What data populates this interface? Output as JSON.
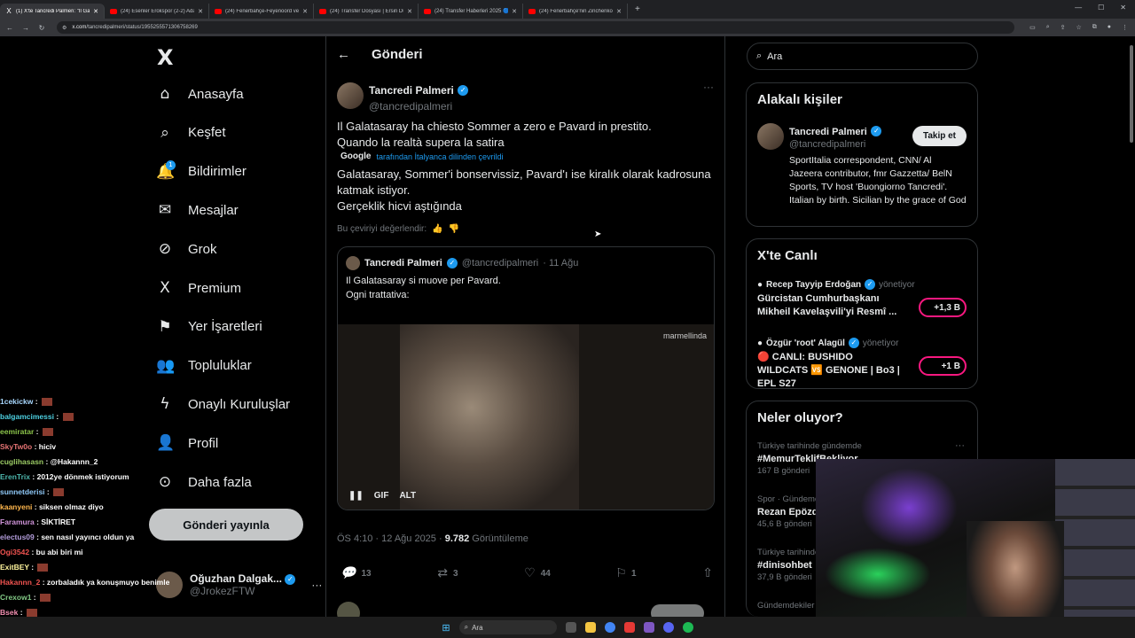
{
  "tabs": [
    {
      "label": "(1) X'te Tancredi Palmeri: \"Il Ga",
      "type": "x",
      "active": true
    },
    {
      "label": "(24) Esenler Erokspor (2-2) Ada",
      "type": "yt"
    },
    {
      "label": "(24) Fenerbahçe-Feyenoord ve",
      "type": "yt"
    },
    {
      "label": "(24) Transfer Dosyası | Ersin Dü",
      "type": "yt"
    },
    {
      "label": "(24) Transfer Haberleri 2025 🔵",
      "type": "yt"
    },
    {
      "label": "(24) Fenerbahçe'nin Zinchenko",
      "type": "yt"
    }
  ],
  "address": {
    "domain": "x.com",
    "path": "/tancredipalmeri/status/1955255571306758269"
  },
  "nav": {
    "logo": "X",
    "items": [
      {
        "label": "Anasayfa",
        "icon": "⌂",
        "name": "home"
      },
      {
        "label": "Keşfet",
        "icon": "⌕",
        "name": "explore"
      },
      {
        "label": "Bildirimler",
        "icon": "🔔",
        "name": "notifications",
        "badge": "1"
      },
      {
        "label": "Mesajlar",
        "icon": "✉",
        "name": "messages"
      },
      {
        "label": "Grok",
        "icon": "⊘",
        "name": "grok"
      },
      {
        "label": "Premium",
        "icon": "X",
        "name": "premium"
      },
      {
        "label": "Yer İşaretleri",
        "icon": "⚑",
        "name": "bookmarks"
      },
      {
        "label": "Topluluklar",
        "icon": "👥",
        "name": "communities"
      },
      {
        "label": "Onaylı Kuruluşlar",
        "icon": "ϟ",
        "name": "verified-orgs"
      },
      {
        "label": "Profil",
        "icon": "👤",
        "name": "profile"
      },
      {
        "label": "Daha fazla",
        "icon": "⊙",
        "name": "more"
      }
    ],
    "post_button": "Gönderi yayınla",
    "account_name": "Oğuzhan Dalgak...",
    "account_handle": "@JrokezFTW"
  },
  "main": {
    "header": "Gönderi",
    "author_name": "Tancredi Palmeri",
    "author_handle": "@tancredipalmeri",
    "text_line1": "Il Galatasaray ha chiesto Sommer a zero e Pavard in prestito.",
    "text_line2": "Quando la realtà supera la satira",
    "translate_brand": "Google",
    "translate_note": "tarafından İtalyanca dilinden çevrildi",
    "translated1": "Galatasaray, Sommer'i bonservissiz, Pavard'ı ise kiralık olarak kadrosuna katmak istiyor.",
    "translated2": "Gerçeklik hicvi aştığında",
    "rate": "Bu çeviriyi değerlendir:",
    "quote": {
      "name": "Tancredi Palmeri",
      "handle": "@tancredipalmeri",
      "date": "· 11 Ağu",
      "line1": "Il Galatasaray si muove per Pavard.",
      "line2": "Ogni trattativa:",
      "watermark": "marmellinda",
      "gif": "GIF",
      "alt": "ALT"
    },
    "time": "ÖS 4:10 · 12 Ağu 2025 ·",
    "views": "9.782",
    "views_label": "Görüntüleme",
    "actions": {
      "replies": "13",
      "reposts": "3",
      "likes": "44",
      "bookmarks": "1"
    }
  },
  "right": {
    "search_placeholder": "Ara",
    "relevant_title": "Alakalı kişiler",
    "rel_name": "Tancredi Palmeri",
    "rel_handle": "@tancredipalmeri",
    "follow": "Takip et",
    "bio": "SportItalia correspondent, CNN/ Al Jazeera contributor, fmr Gazzetta/ BelN Sports, TV host 'Buongiorno Tancredi'. Italian by birth. Sicilian by the grace of God",
    "live_title": "X'te Canlı",
    "live": [
      {
        "host": "Recep Tayyip Erdoğan",
        "role": "yönetiyor",
        "title": "Gürcistan Cumhurbaşkanı Mikheil Kavelaşvili'yi Resmî ...",
        "count": "+1,3 B"
      },
      {
        "host": "Özgür 'root' Alagül",
        "role": "yönetiyor",
        "title": "🔴 CANLI: BUSHIDO WILDCATS 🆚 GENONE | Bo3 | EPL S27",
        "count": "+1 B"
      }
    ],
    "trends_title": "Neler oluyor?",
    "trends": [
      {
        "context": "Türkiye tarihinde gündemde",
        "name": "#MemurTeklifBekliyor",
        "count": "167 B gönderi"
      },
      {
        "context": "Spor · Gündemde",
        "name": "Rezan Epözdemir",
        "count": "45,6 B gönderi"
      },
      {
        "context": "Türkiye tarihinde gündemde",
        "name": "#dinisohbet",
        "count": "37,9 B gönderi"
      },
      {
        "context": "Gündemdekiler",
        "name": "",
        "count": ""
      }
    ]
  },
  "chat": [
    {
      "user": "1cekickw",
      "msg": "",
      "color": "#a8d8ff"
    },
    {
      "user": "balgamcimessi",
      "msg": "",
      "color": "#4dd0e1"
    },
    {
      "user": "eemiratar",
      "msg": "",
      "color": "#8bc34a"
    },
    {
      "user": "SkyTw0o",
      "msg": "hiciv",
      "color": "#e57373"
    },
    {
      "user": "cuglihasasn",
      "msg": "@Hakannn_2",
      "color": "#9ccc65"
    },
    {
      "user": "ErenTrix",
      "msg": "2012ye dönmek istiyorum",
      "color": "#4db6ac"
    },
    {
      "user": "sunnetderisi",
      "msg": "",
      "color": "#90caf9"
    },
    {
      "user": "kaanyeni",
      "msg": "siksen olmaz diyo",
      "color": "#ffb74d"
    },
    {
      "user": "Faramura",
      "msg": "SİKTİRET",
      "color": "#ce93d8"
    },
    {
      "user": "electus09",
      "msg": "sen nasıl yayıncı oldun ya",
      "color": "#b39ddb"
    },
    {
      "user": "Ogi3542",
      "msg": "bu abi biri mi",
      "color": "#ef5350"
    },
    {
      "user": "ExitBEY",
      "msg": "",
      "color": "#fff59d"
    },
    {
      "user": "Hakannn_2",
      "msg": "zorbaladık ya konuşmuyo benimle",
      "color": "#ef5350"
    },
    {
      "user": "Crexow1",
      "msg": "",
      "color": "#81c784"
    },
    {
      "user": "Bsek",
      "msg": "",
      "color": "#f48fb1"
    }
  ],
  "taskbar": {
    "search": "Ara"
  },
  "colors": {
    "accent": "#1d9bf0",
    "live": "#f91880"
  }
}
